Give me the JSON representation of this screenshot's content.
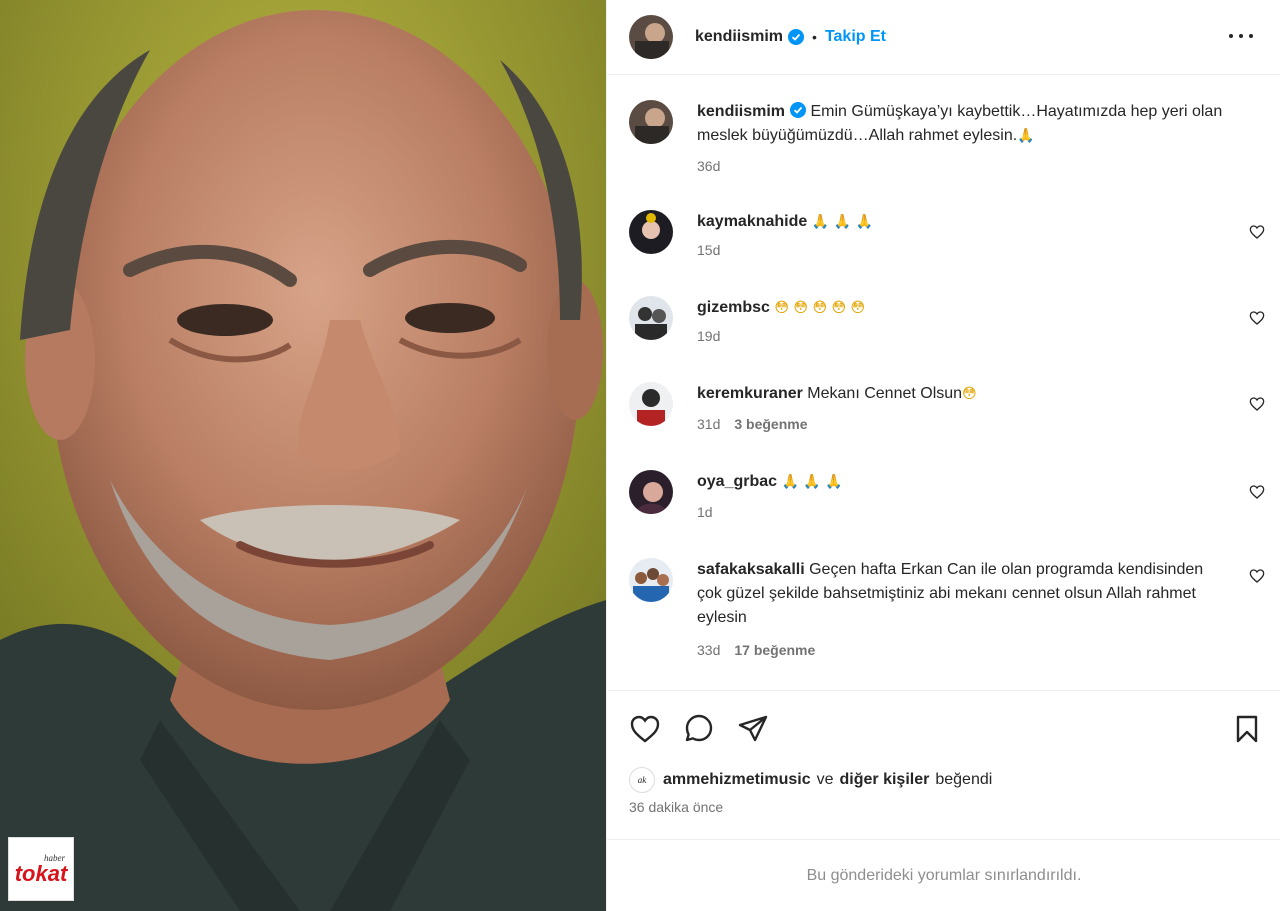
{
  "post": {
    "author": "kendiismim",
    "follow_label": "Takip Et",
    "separator": "•",
    "caption": "Emin Gümüşkaya’yı kaybettik…Hayatımızda hep yeri olan meslek büyüğümüzdü…Allah rahmet eylesin.",
    "caption_emoji": "🙏",
    "caption_time": "36d",
    "watermark_small": "haber",
    "watermark_big": "tokat"
  },
  "comments": [
    {
      "user": "kaymaknahide",
      "text": "",
      "emoji": "🙏 🙏 🙏",
      "time": "15d",
      "likes": ""
    },
    {
      "user": "gizembsc",
      "text": "",
      "emoji": "😳 😳 😳 😳 😳",
      "time": "19d",
      "likes": ""
    },
    {
      "user": "keremkuraner",
      "text": "Mekanı Cennet Olsun",
      "emoji": "😳",
      "time": "31d",
      "likes": "3 beğenme"
    },
    {
      "user": "oya_grbac",
      "text": "",
      "emoji": "🙏 🙏 🙏",
      "time": "1d",
      "likes": ""
    },
    {
      "user": "safakaksakalli",
      "text": "Geçen hafta Erkan Can ile olan programda kendisinden çok güzel şekilde bahsetmiştiniz abi mekanı cennet olsun Allah rahmet eylesin",
      "emoji": "",
      "time": "33d",
      "likes": "17 beğenme"
    }
  ],
  "likes_line": {
    "user": "ammehizmetimusic",
    "conj": "ve",
    "others": "diğer kişiler",
    "suffix": "beğendi"
  },
  "time_ago": "36 dakika önce",
  "comments_limited": "Bu gönderideki yorumlar sınırlandırıldı.",
  "colors": {
    "accent": "#0095f6",
    "muted": "#737373",
    "border": "#efefef"
  },
  "icons": [
    "verified-badge-icon",
    "more-options-icon",
    "heart-icon",
    "comment-icon",
    "share-icon",
    "bookmark-icon"
  ]
}
